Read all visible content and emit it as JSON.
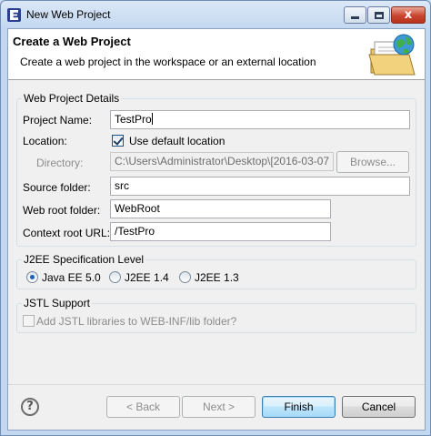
{
  "window": {
    "title": "New Web Project",
    "controls": {
      "minimize_icon": "minimize-icon",
      "maximize_icon": "maximize-icon",
      "close_icon": "close-icon",
      "close_glyph": "x"
    },
    "app_icon": "eclipse-icon"
  },
  "banner": {
    "title": "Create a Web Project",
    "description": "Create a web project in the workspace or an external location",
    "art_icon": "web-project-folder-globe-icon"
  },
  "details": {
    "group_label": "Web Project Details",
    "project_name": {
      "label": "Project Name:",
      "value": "TestPro"
    },
    "location": {
      "label": "Location:",
      "checkbox_label": "Use default location",
      "checked": true
    },
    "directory": {
      "label": "Directory:",
      "value": "C:\\Users\\Administrator\\Desktop\\[2016-03-07",
      "browse_label": "Browse..."
    },
    "source_folder": {
      "label": "Source folder:",
      "value": "src"
    },
    "web_root_folder": {
      "label": "Web root folder:",
      "value": "WebRoot"
    },
    "context_root_url": {
      "label": "Context root URL:",
      "value": "/TestPro"
    }
  },
  "j2ee": {
    "group_label": "J2EE Specification Level",
    "options": [
      {
        "label": "Java EE 5.0",
        "selected": true
      },
      {
        "label": "J2EE 1.4",
        "selected": false
      },
      {
        "label": "J2EE 1.3",
        "selected": false
      }
    ]
  },
  "jstl": {
    "group_label": "JSTL Support",
    "checkbox_label": "Add JSTL libraries to WEB-INF/lib folder?",
    "checked": false,
    "enabled": false
  },
  "buttons": {
    "help_glyph": "?",
    "back": "< Back",
    "next": "Next >",
    "finish": "Finish",
    "cancel": "Cancel"
  },
  "colors": {
    "title_bar": "#c3d8f0",
    "dialog_bg": "#f0f0f0",
    "close_button": "#c9452f",
    "accent_blue": "#3c7fb1"
  }
}
